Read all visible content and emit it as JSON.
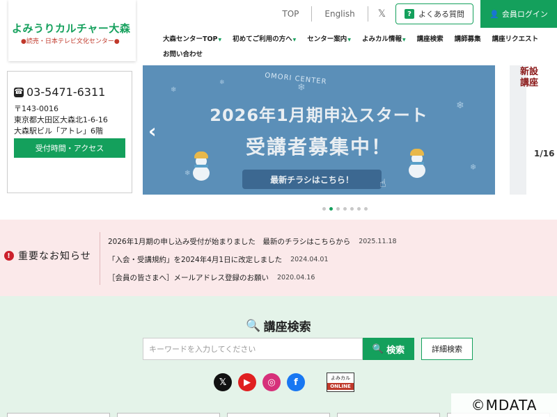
{
  "logo": {
    "main": "よみうりカルチャー大森",
    "sub": "読売・日本テレビ文化センター"
  },
  "toplinks": {
    "top": "TOP",
    "english": "English",
    "x": "𝕏",
    "faq": "よくある質問",
    "login": "会員ログイン"
  },
  "nav": {
    "row1": [
      {
        "label": "大森センターTOP",
        "caret": true
      },
      {
        "label": "初めてご利用の方へ",
        "caret": true
      },
      {
        "label": "センター案内",
        "caret": true
      },
      {
        "label": "よみカル情報",
        "caret": true
      },
      {
        "label": "講座検索",
        "caret": false
      },
      {
        "label": "講師募集",
        "caret": false
      },
      {
        "label": "講座リクエスト",
        "caret": false
      }
    ],
    "row2": [
      {
        "label": "お問い合わせ",
        "caret": false
      }
    ]
  },
  "contact": {
    "phone": "03-5471-6311",
    "postal": "〒143-0016",
    "address1": "東京都大田区大森北1-6-16",
    "address2": "大森駅ビル「アトレ」6階",
    "access_button": "受付時間・アクセス"
  },
  "slide": {
    "brand": "OMORI CENTER",
    "title1": "2026年1月期申込スタート",
    "title2": "受講者募集中！",
    "flyer": "最新チラシはこちら！",
    "prev": "‹",
    "next": "›"
  },
  "side_slide": {
    "label1": "新設",
    "label2": "講座",
    "date": "1/16"
  },
  "carousel_dots": {
    "count": 7,
    "active": 1
  },
  "notice": {
    "title": "重要なお知らせ",
    "items": [
      {
        "text": "2026年1月期の申し込み受付が始まりました　最新のチラシはこちらから",
        "date": "2025.11.18"
      },
      {
        "text": "「入会・受講規約」を2024年4月1日に改定しました",
        "date": "2024.04.01"
      },
      {
        "text": "［会員の皆さまへ］メールアドレス登録のお願い",
        "date": "2020.04.16"
      }
    ]
  },
  "search": {
    "title": "講座検索",
    "placeholder": "キーワードを入力してください",
    "button": "検索",
    "advanced": "詳細検索"
  },
  "social": {
    "x": "𝕏",
    "youtube": "▶",
    "instagram": "◎",
    "facebook": "f",
    "online_top": "よみカル",
    "online_bottom": "ONLINE"
  },
  "copyright": "©MDATA",
  "colors": {
    "brand_green": "#14a05c",
    "notice_bg": "#fbe9ea",
    "search_bg": "#e4f3e9",
    "slide_bg": "#5b8fb8",
    "alert_red": "#cc1f2b"
  }
}
